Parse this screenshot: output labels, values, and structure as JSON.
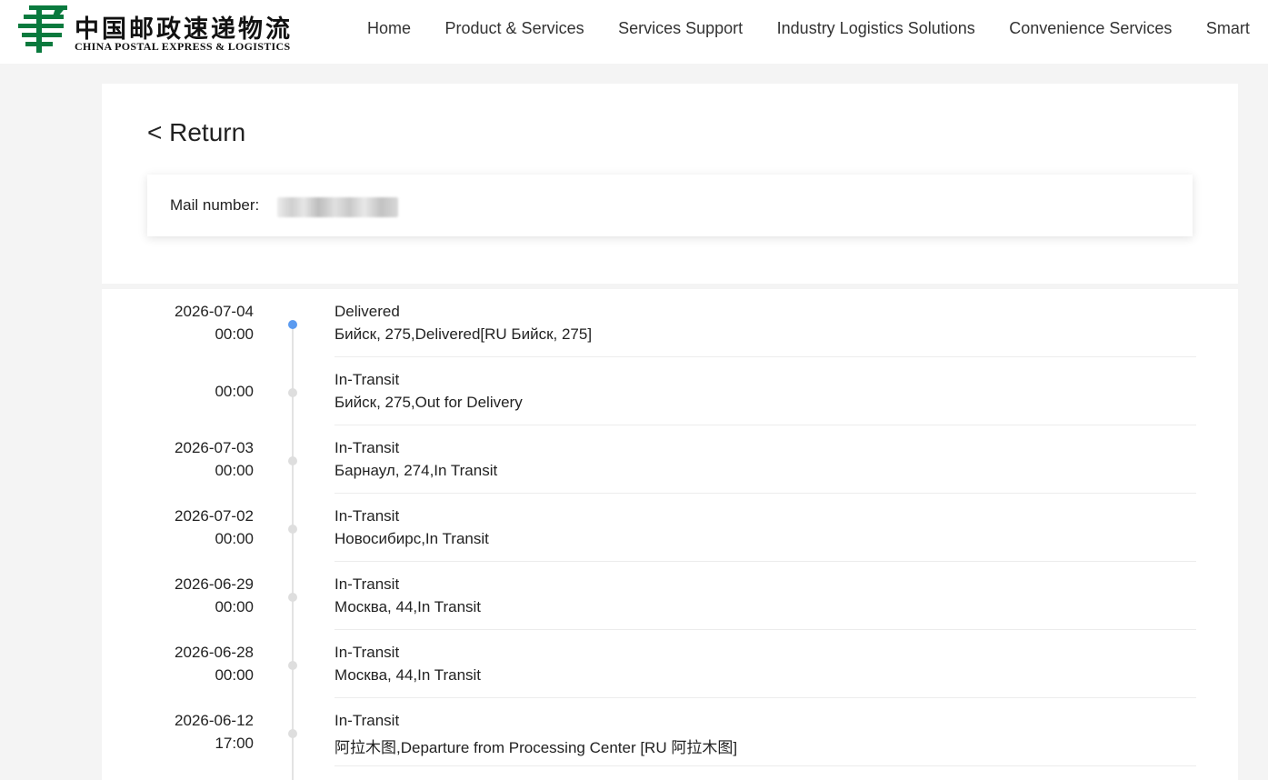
{
  "header": {
    "logo_cn": "中国邮政速递物流",
    "logo_en": "CHINA POSTAL EXPRESS & LOGISTICS",
    "logo_icon": "china-post-logo-icon",
    "nav": [
      "Home",
      "Product & Services",
      "Services Support",
      "Industry Logistics Solutions",
      "Convenience Services",
      "Smart"
    ]
  },
  "page": {
    "return_label": "< Return",
    "mail_label": "Mail number:",
    "mail_number_redacted": true
  },
  "colors": {
    "brand_green": "#0a7a3e",
    "active_dot": "#5b9bf0",
    "inactive_dot": "#dedede"
  },
  "events": [
    {
      "date": "2026-07-04",
      "time": "00:00",
      "status": "Delivered",
      "desc": "Бийск, 275,Delivered[RU Бийск, 275]",
      "active": true
    },
    {
      "date": "",
      "time": "00:00",
      "status": "In-Transit",
      "desc": "Бийск, 275,Out for Delivery",
      "active": false
    },
    {
      "date": "2026-07-03",
      "time": "00:00",
      "status": "In-Transit",
      "desc": "Барнаул, 274,In Transit",
      "active": false
    },
    {
      "date": "2026-07-02",
      "time": "00:00",
      "status": "In-Transit",
      "desc": "Новосибирс,In Transit",
      "active": false
    },
    {
      "date": "2026-06-29",
      "time": "00:00",
      "status": "In-Transit",
      "desc": "Москва, 44,In Transit",
      "active": false
    },
    {
      "date": "2026-06-28",
      "time": "00:00",
      "status": "In-Transit",
      "desc": "Москва, 44,In Transit",
      "active": false
    },
    {
      "date": "2026-06-12",
      "time": "17:00",
      "status": "In-Transit",
      "desc": "阿拉木图,Departure from Processing Center [RU 阿拉木图]",
      "active": false
    }
  ]
}
